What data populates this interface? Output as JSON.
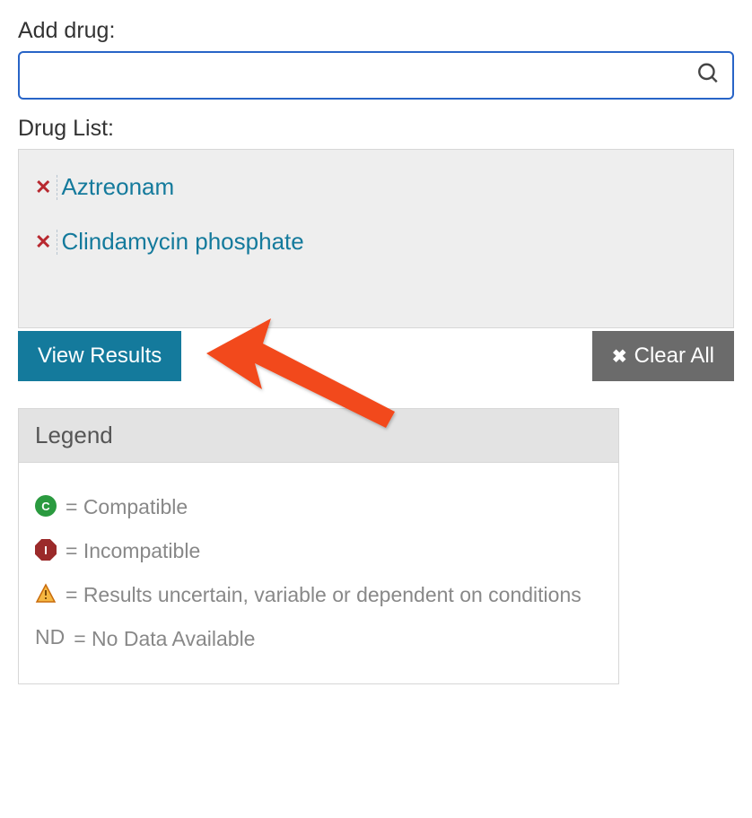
{
  "addDrug": {
    "label": "Add drug:",
    "placeholder": ""
  },
  "drugList": {
    "label": "Drug List:",
    "items": [
      {
        "name": "Aztreonam"
      },
      {
        "name": "Clindamycin phosphate"
      }
    ]
  },
  "buttons": {
    "viewResults": "View Results",
    "clearAll": "Clear All"
  },
  "legend": {
    "title": "Legend",
    "compatible": "= Compatible",
    "incompatible": "= Incompatible",
    "uncertain": "= Results uncertain, variable or dependent on conditions",
    "nodataLabel": "ND",
    "nodata": "= No Data Available"
  }
}
